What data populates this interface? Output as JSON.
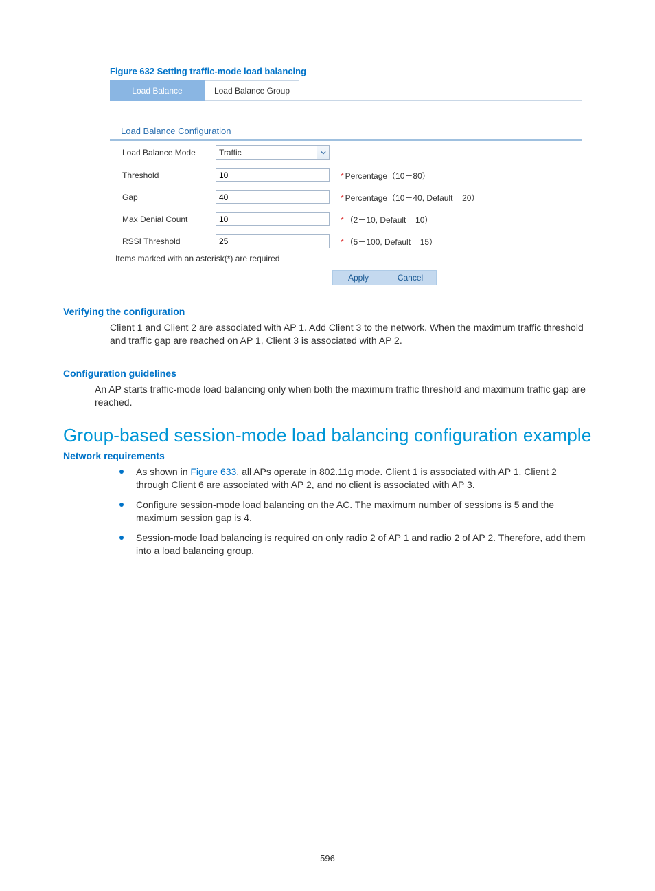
{
  "figure": {
    "caption": "Figure 632 Setting traffic-mode load balancing",
    "tabs": {
      "active": "Load Balance",
      "other": "Load Balance Group"
    },
    "panel_title": "Load Balance Configuration",
    "rows": {
      "mode": {
        "label": "Load Balance Mode",
        "value": "Traffic"
      },
      "threshold": {
        "label": "Threshold",
        "value": "10",
        "hint": "Percentage（10－80）"
      },
      "gap": {
        "label": "Gap",
        "value": "40",
        "hint": "Percentage（10－40, Default = 20）"
      },
      "max_denial": {
        "label": "Max Denial Count",
        "value": "10",
        "hint": "（2－10, Default = 10）"
      },
      "rssi": {
        "label": "RSSI Threshold",
        "value": "25",
        "hint": "（5－100, Default = 15）"
      }
    },
    "required_note": "Items marked with an asterisk(*) are required",
    "buttons": {
      "apply": "Apply",
      "cancel": "Cancel"
    }
  },
  "sections": {
    "verify_title": "Verifying the configuration",
    "verify_body": "Client 1 and Client 2 are associated with AP 1. Add Client 3 to the network. When the maximum traffic threshold and traffic gap are reached on AP 1, Client 3 is associated with AP 2.",
    "guidelines_title": "Configuration guidelines",
    "guidelines_body": "An AP starts traffic-mode load balancing only when both the maximum traffic threshold and maximum traffic gap are reached.",
    "main_heading": "Group-based session-mode load balancing configuration example",
    "net_req_title": "Network requirements",
    "bullet1_pre": "As shown in ",
    "bullet1_link": "Figure 633",
    "bullet1_post": ", all APs operate in 802.11g mode. Client 1 is associated with AP 1. Client 2 through Client 6 are associated with AP 2, and no client is associated with AP 3.",
    "bullet2": "Configure session-mode load balancing on the AC. The maximum number of sessions is 5 and the maximum session gap is 4.",
    "bullet3": "Session-mode load balancing is required on only radio 2 of AP 1 and radio 2 of AP 2. Therefore, add them into a load balancing group."
  },
  "page_number": "596"
}
